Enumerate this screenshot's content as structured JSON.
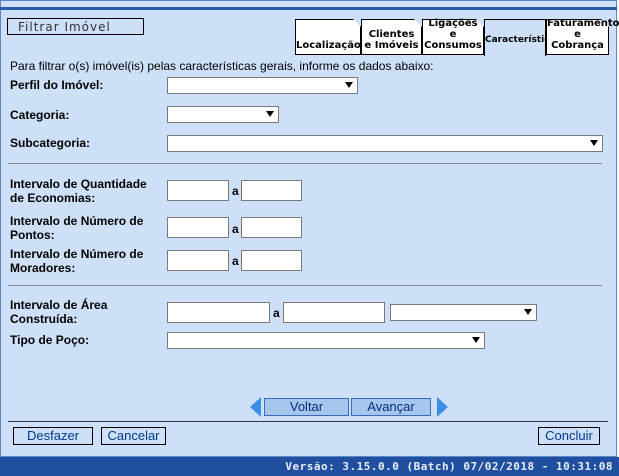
{
  "panel": {
    "title": "Filtrar Imóvel",
    "tabs": [
      {
        "line1": "Localização",
        "line2": ""
      },
      {
        "line1": "Clientes",
        "line2": "e Imóveis"
      },
      {
        "line1": "Ligações",
        "line2": "e Consumos"
      },
      {
        "line1": "Característica",
        "line2": ""
      },
      {
        "line1": "Faturamento",
        "line2": "e Cobrança"
      }
    ],
    "active_tab": "Característica"
  },
  "form": {
    "intro": "Para filtrar o(s) imóvel(is) pelas características gerais, informe os dados abaixo:",
    "perfil_label": "Perfil do Imóvel:",
    "perfil_value": "",
    "categoria_label": "Categoria:",
    "categoria_value": "",
    "subcategoria_label": "Subcategoria:",
    "subcategoria_value": "",
    "economias_label_1": "Intervalo de Quantidade",
    "economias_label_2": "de Economias:",
    "pontos_label_1": "Intervalo de Número de",
    "pontos_label_2": "Pontos:",
    "moradores_label_1": "Intervalo de Número de",
    "moradores_label_2": "Moradores:",
    "area_label_1": "Intervalo de Área",
    "area_label_2": "Construída:",
    "area_unit_value": "",
    "poco_label": "Tipo de Poço:",
    "poco_value": "",
    "a_sep": "a"
  },
  "buttons": {
    "voltar": "Voltar",
    "avancar": "Avançar",
    "desfazer": "Desfazer",
    "cancelar": "Cancelar",
    "concluir": "Concluir"
  },
  "status": {
    "version": "Versão: 3.15.0.0 (Batch) 07/02/2018 - 10:31:08"
  },
  "colors": {
    "panel_bg": "#cde0f7",
    "status_bg": "#1f4f9e",
    "nav_arrow": "#3a8ee6"
  }
}
